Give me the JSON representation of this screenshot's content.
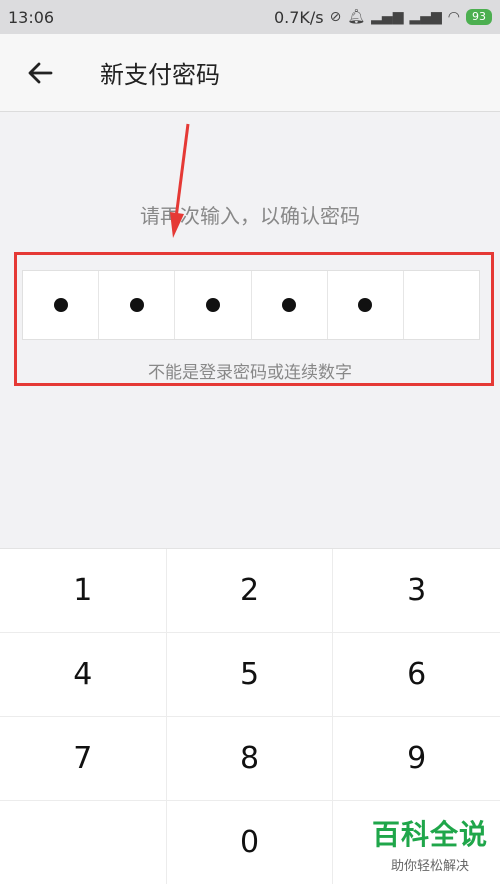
{
  "status_bar": {
    "time": "13:06",
    "network_speed": "0.7K/s",
    "battery": "93"
  },
  "app_bar": {
    "title": "新支付密码"
  },
  "prompt_text": "请再次输入，以确认密码",
  "password": {
    "total_digits": 6,
    "entered_digits": 5
  },
  "hint_text": "不能是登录密码或连续数字",
  "keypad": {
    "keys": [
      "1",
      "2",
      "3",
      "4",
      "5",
      "6",
      "7",
      "8",
      "9",
      "",
      "0",
      ""
    ]
  },
  "watermark": {
    "line1": "百科全说",
    "line2": "助你轻松解决"
  },
  "colors": {
    "highlight": "#e53935",
    "watermark": "#1fa64a"
  }
}
